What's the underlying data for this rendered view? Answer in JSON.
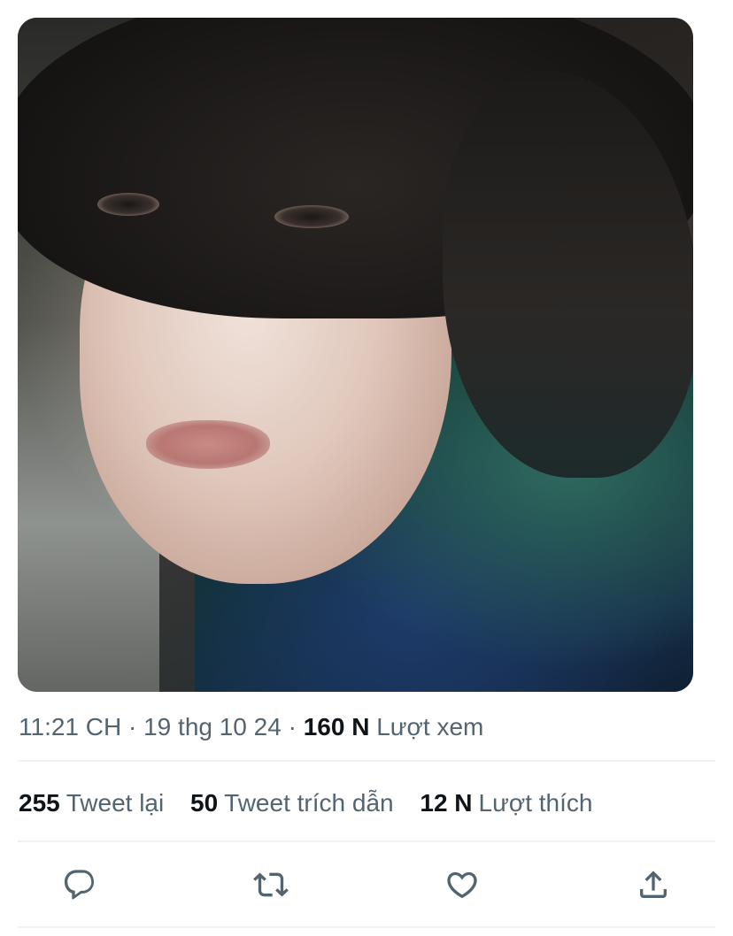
{
  "tweet": {
    "meta": {
      "time": "11:21 CH",
      "separator": "·",
      "date": "19 thg 10 24",
      "views_count": "160 N",
      "views_label": "Lượt xem"
    },
    "stats": [
      {
        "count": "255",
        "label": "Tweet lại"
      },
      {
        "count": "50",
        "label": "Tweet trích dẫn"
      },
      {
        "count": "12 N",
        "label": "Lượt thích"
      }
    ],
    "actions": [
      {
        "icon": "reply-icon"
      },
      {
        "icon": "retweet-icon"
      },
      {
        "icon": "like-icon"
      },
      {
        "icon": "share-icon"
      }
    ],
    "colors": {
      "secondary_text": "#536471",
      "primary_text": "#0f1419",
      "divider": "#eff3f4"
    }
  }
}
